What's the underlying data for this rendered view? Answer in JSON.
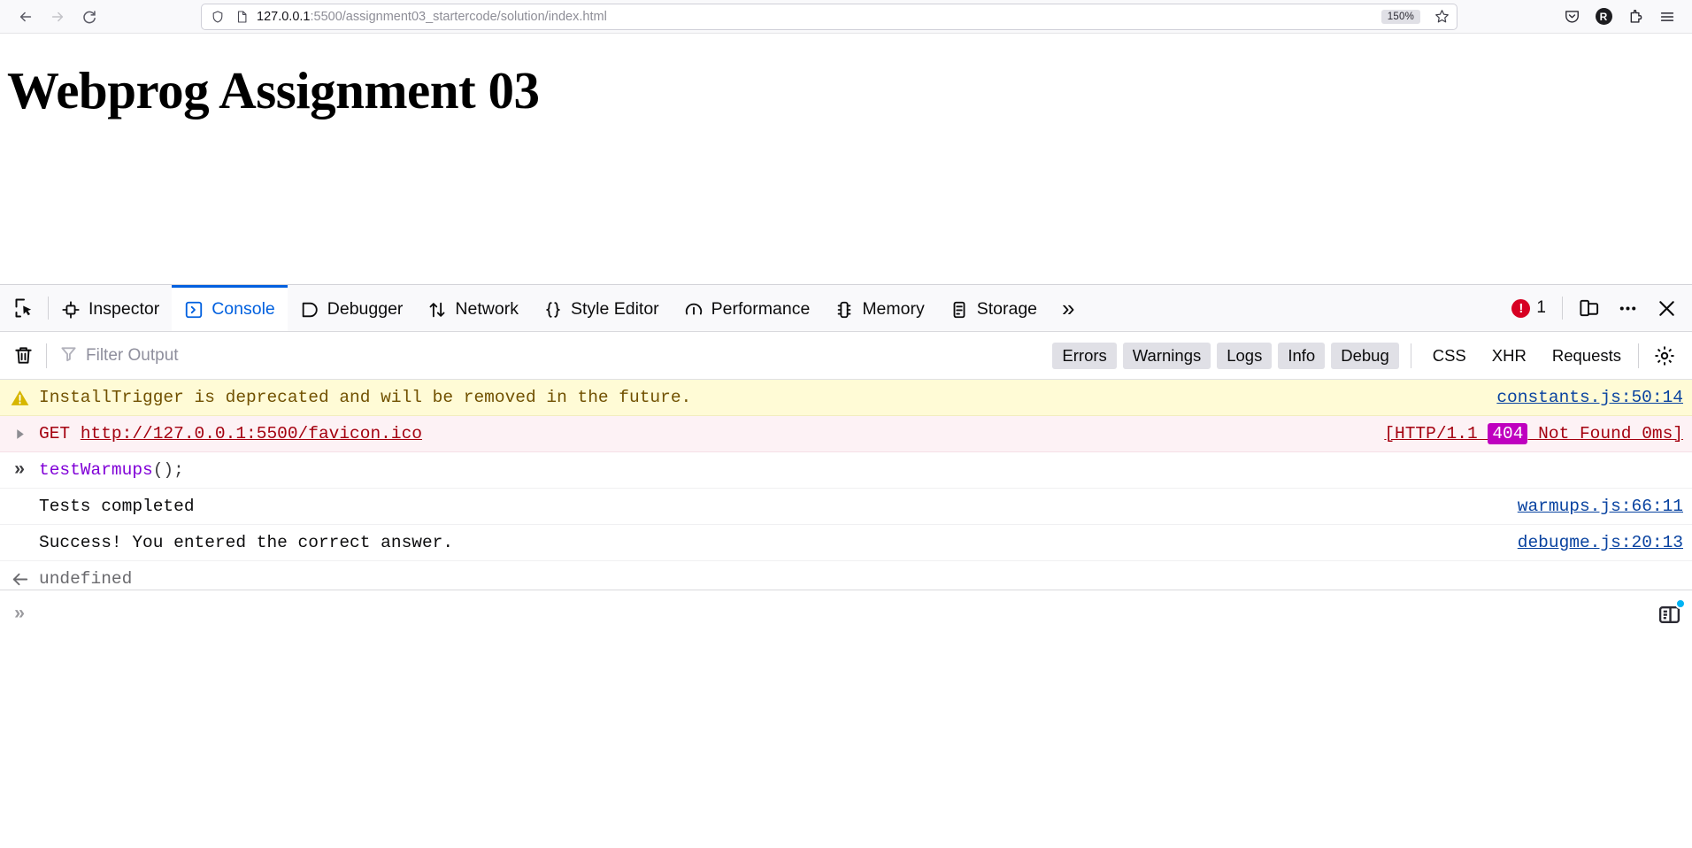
{
  "browser": {
    "nav": {
      "back_icon": "arrow-left-icon",
      "forward_icon": "arrow-right-icon",
      "reload_icon": "reload-icon"
    },
    "urlbar": {
      "shield_icon": "shield-icon",
      "page_icon": "page-document-icon",
      "url_host": "127.0.0.1",
      "url_path": ":5500/assignment03_startercode/solution/index.html",
      "zoom_level": "150%",
      "bookmark_icon": "star-icon"
    },
    "toolbar_right": {
      "pocket_icon": "pocket-save-icon",
      "account_initial": "R",
      "extensions_icon": "extensions-puzzle-icon",
      "menu_icon": "hamburger-menu-icon"
    }
  },
  "page": {
    "title": "Webprog Assignment 03"
  },
  "devtools": {
    "picker_icon": "element-picker-icon",
    "tabs": [
      {
        "label": "Inspector",
        "icon": "inspector-icon",
        "active": false
      },
      {
        "label": "Console",
        "icon": "console-chevron-icon",
        "active": true
      },
      {
        "label": "Debugger",
        "icon": "debugger-icon",
        "active": false
      },
      {
        "label": "Network",
        "icon": "network-arrows-icon",
        "active": false
      },
      {
        "label": "Style Editor",
        "icon": "braces-icon",
        "active": false
      },
      {
        "label": "Performance",
        "icon": "performance-gauge-icon",
        "active": false
      },
      {
        "label": "Memory",
        "icon": "memory-chip-icon",
        "active": false
      },
      {
        "label": "Storage",
        "icon": "storage-database-icon",
        "active": false
      }
    ],
    "overflow_label": "»",
    "error_count": "1",
    "error_icon": "error-exclamation-icon",
    "responsive_icon": "responsive-design-mode-icon",
    "meatball_icon": "more-options-icon",
    "close_icon": "close-icon",
    "filterbar": {
      "trash_icon": "trash-clear-icon",
      "filter_icon": "filter-funnel-icon",
      "filter_placeholder": "Filter Output",
      "filter_value": "",
      "pills": [
        {
          "label": "Errors",
          "active": true
        },
        {
          "label": "Warnings",
          "active": true
        },
        {
          "label": "Logs",
          "active": true
        },
        {
          "label": "Info",
          "active": true
        },
        {
          "label": "Debug",
          "active": true
        },
        {
          "label": "CSS",
          "active": false
        },
        {
          "label": "XHR",
          "active": false
        },
        {
          "label": "Requests",
          "active": false
        }
      ],
      "settings_icon": "gear-settings-icon"
    },
    "messages": [
      {
        "type": "warning",
        "icon": "warning-triangle-icon",
        "text": "InstallTrigger is deprecated and will be removed in the future.",
        "source": "constants.js:50:14"
      },
      {
        "type": "network-error",
        "icon": "expand-triangle-icon",
        "method": "GET",
        "url": "http://127.0.0.1:5500/favicon.ico",
        "status_prefix": "[HTTP/1.1 ",
        "status_code": "404",
        "status_suffix": " Not Found 0ms]"
      },
      {
        "type": "input",
        "icon": "input-chevrons-icon",
        "fn": "testWarmups",
        "punctuation": "();"
      },
      {
        "type": "log",
        "text": "Tests completed",
        "source": "warmups.js:66:11"
      },
      {
        "type": "log",
        "text": "Success! You entered the correct answer.",
        "source": "debugme.js:20:13"
      },
      {
        "type": "result",
        "icon": "return-arrow-icon",
        "text": "undefined"
      }
    ],
    "prompt": {
      "caret": "»",
      "value": "",
      "editor_toggle_icon": "editor-mode-icon"
    }
  }
}
